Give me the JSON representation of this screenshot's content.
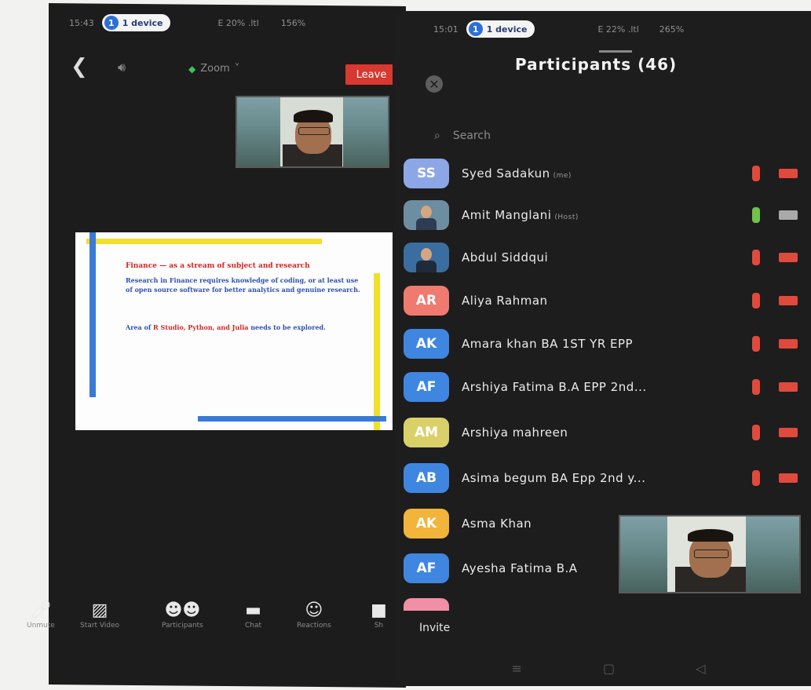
{
  "left_status": {
    "time": "15:43",
    "device_count": "1",
    "device_label": "1 device",
    "signal": "E 20% .ltl",
    "battery": "156%"
  },
  "right_status": {
    "time": "15:01",
    "device_count": "1",
    "device_label": "1 device",
    "signal": "E 22% .ltl",
    "battery": "265%"
  },
  "meeting": {
    "back_icon": "chevron-left-icon",
    "speaker_icon": "speaker-icon",
    "zoom_label": "Zoom",
    "leave_label": "Leave"
  },
  "slide": {
    "title": "Finance — as a stream of subject and research",
    "para1": "Research in Finance requires knowledge of coding, or at least use of open source software for better analytics and genuine research.",
    "para2_prefix": "Area of ",
    "para2_highlight": "R Studio, Python, and Julia",
    "para2_suffix": " needs to be explored."
  },
  "toolbar": [
    {
      "icon": "mic-off-icon",
      "label": "Unmute"
    },
    {
      "icon": "video-off-icon",
      "label": "Start Video"
    },
    {
      "icon": "participants-icon",
      "label": "Participants"
    },
    {
      "icon": "chat-icon",
      "label": "Chat"
    },
    {
      "icon": "reactions-icon",
      "label": "Reactions"
    },
    {
      "icon": "share-icon",
      "label": "Sh"
    }
  ],
  "participants": {
    "title": "Participants (46)",
    "search_placeholder": "Search",
    "invite_label": "Invite",
    "list": [
      {
        "initials": "SS",
        "name": "Syed Sadakun",
        "role": "(me)",
        "color": "#8da7e6",
        "muted": true
      },
      {
        "initials": "",
        "name": "Amit Manglani",
        "role": "(Host)",
        "color": "#6d8da0",
        "muted": false
      },
      {
        "initials": "",
        "name": "Abdul Siddqui",
        "role": "",
        "color": "#3a6ea0",
        "muted": true
      },
      {
        "initials": "AR",
        "name": "Aliya Rahman",
        "role": "",
        "color": "#f07a70",
        "muted": true
      },
      {
        "initials": "AK",
        "name": "Amara khan BA 1ST YR EPP",
        "role": "",
        "color": "#3f86e0",
        "muted": true
      },
      {
        "initials": "AF",
        "name": "Arshiya Fatima B.A EPP 2nd...",
        "role": "",
        "color": "#3f86e0",
        "muted": true
      },
      {
        "initials": "AM",
        "name": "Arshiya mahreen",
        "role": "",
        "color": "#d9d06a",
        "muted": true
      },
      {
        "initials": "AB",
        "name": "Asima begum BA Epp 2nd y...",
        "role": "",
        "color": "#3f86e0",
        "muted": true
      },
      {
        "initials": "AK",
        "name": "Asma Khan",
        "role": "",
        "color": "#f2b43a",
        "muted": true
      },
      {
        "initials": "AF",
        "name": "Ayesha Fatima B.A",
        "role": "",
        "color": "#3f86e0",
        "muted": true
      }
    ]
  },
  "colors": {
    "muted_mic": "#e04a3c",
    "active_mic": "#6fc34a",
    "cam_off": "#e04a3c",
    "cam_on": "#aaaaaa",
    "leave": "#d8382f"
  }
}
